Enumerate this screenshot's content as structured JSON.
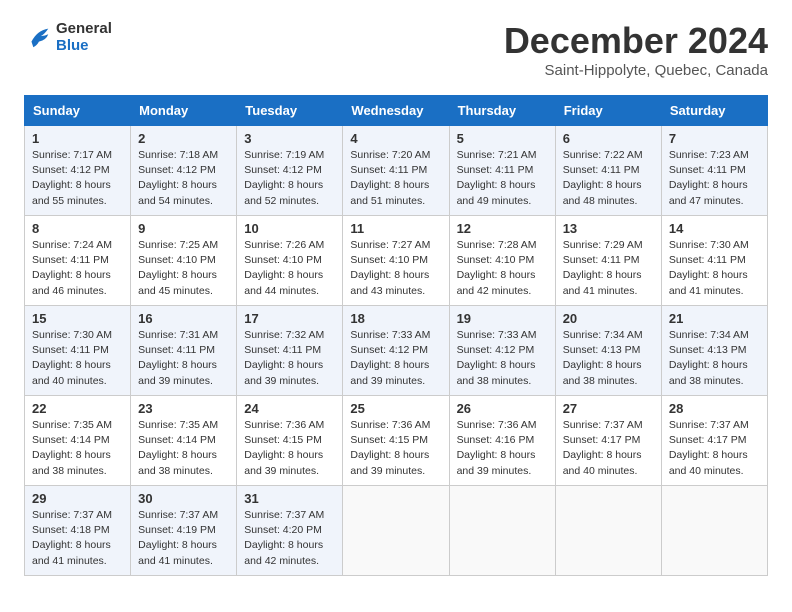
{
  "logo": {
    "line1": "General",
    "line2": "Blue"
  },
  "title": "December 2024",
  "location": "Saint-Hippolyte, Quebec, Canada",
  "weekdays": [
    "Sunday",
    "Monday",
    "Tuesday",
    "Wednesday",
    "Thursday",
    "Friday",
    "Saturday"
  ],
  "weeks": [
    [
      {
        "day": "1",
        "sunrise": "Sunrise: 7:17 AM",
        "sunset": "Sunset: 4:12 PM",
        "daylight": "Daylight: 8 hours and 55 minutes."
      },
      {
        "day": "2",
        "sunrise": "Sunrise: 7:18 AM",
        "sunset": "Sunset: 4:12 PM",
        "daylight": "Daylight: 8 hours and 54 minutes."
      },
      {
        "day": "3",
        "sunrise": "Sunrise: 7:19 AM",
        "sunset": "Sunset: 4:12 PM",
        "daylight": "Daylight: 8 hours and 52 minutes."
      },
      {
        "day": "4",
        "sunrise": "Sunrise: 7:20 AM",
        "sunset": "Sunset: 4:11 PM",
        "daylight": "Daylight: 8 hours and 51 minutes."
      },
      {
        "day": "5",
        "sunrise": "Sunrise: 7:21 AM",
        "sunset": "Sunset: 4:11 PM",
        "daylight": "Daylight: 8 hours and 49 minutes."
      },
      {
        "day": "6",
        "sunrise": "Sunrise: 7:22 AM",
        "sunset": "Sunset: 4:11 PM",
        "daylight": "Daylight: 8 hours and 48 minutes."
      },
      {
        "day": "7",
        "sunrise": "Sunrise: 7:23 AM",
        "sunset": "Sunset: 4:11 PM",
        "daylight": "Daylight: 8 hours and 47 minutes."
      }
    ],
    [
      {
        "day": "8",
        "sunrise": "Sunrise: 7:24 AM",
        "sunset": "Sunset: 4:11 PM",
        "daylight": "Daylight: 8 hours and 46 minutes."
      },
      {
        "day": "9",
        "sunrise": "Sunrise: 7:25 AM",
        "sunset": "Sunset: 4:10 PM",
        "daylight": "Daylight: 8 hours and 45 minutes."
      },
      {
        "day": "10",
        "sunrise": "Sunrise: 7:26 AM",
        "sunset": "Sunset: 4:10 PM",
        "daylight": "Daylight: 8 hours and 44 minutes."
      },
      {
        "day": "11",
        "sunrise": "Sunrise: 7:27 AM",
        "sunset": "Sunset: 4:10 PM",
        "daylight": "Daylight: 8 hours and 43 minutes."
      },
      {
        "day": "12",
        "sunrise": "Sunrise: 7:28 AM",
        "sunset": "Sunset: 4:10 PM",
        "daylight": "Daylight: 8 hours and 42 minutes."
      },
      {
        "day": "13",
        "sunrise": "Sunrise: 7:29 AM",
        "sunset": "Sunset: 4:11 PM",
        "daylight": "Daylight: 8 hours and 41 minutes."
      },
      {
        "day": "14",
        "sunrise": "Sunrise: 7:30 AM",
        "sunset": "Sunset: 4:11 PM",
        "daylight": "Daylight: 8 hours and 41 minutes."
      }
    ],
    [
      {
        "day": "15",
        "sunrise": "Sunrise: 7:30 AM",
        "sunset": "Sunset: 4:11 PM",
        "daylight": "Daylight: 8 hours and 40 minutes."
      },
      {
        "day": "16",
        "sunrise": "Sunrise: 7:31 AM",
        "sunset": "Sunset: 4:11 PM",
        "daylight": "Daylight: 8 hours and 39 minutes."
      },
      {
        "day": "17",
        "sunrise": "Sunrise: 7:32 AM",
        "sunset": "Sunset: 4:11 PM",
        "daylight": "Daylight: 8 hours and 39 minutes."
      },
      {
        "day": "18",
        "sunrise": "Sunrise: 7:33 AM",
        "sunset": "Sunset: 4:12 PM",
        "daylight": "Daylight: 8 hours and 39 minutes."
      },
      {
        "day": "19",
        "sunrise": "Sunrise: 7:33 AM",
        "sunset": "Sunset: 4:12 PM",
        "daylight": "Daylight: 8 hours and 38 minutes."
      },
      {
        "day": "20",
        "sunrise": "Sunrise: 7:34 AM",
        "sunset": "Sunset: 4:13 PM",
        "daylight": "Daylight: 8 hours and 38 minutes."
      },
      {
        "day": "21",
        "sunrise": "Sunrise: 7:34 AM",
        "sunset": "Sunset: 4:13 PM",
        "daylight": "Daylight: 8 hours and 38 minutes."
      }
    ],
    [
      {
        "day": "22",
        "sunrise": "Sunrise: 7:35 AM",
        "sunset": "Sunset: 4:14 PM",
        "daylight": "Daylight: 8 hours and 38 minutes."
      },
      {
        "day": "23",
        "sunrise": "Sunrise: 7:35 AM",
        "sunset": "Sunset: 4:14 PM",
        "daylight": "Daylight: 8 hours and 38 minutes."
      },
      {
        "day": "24",
        "sunrise": "Sunrise: 7:36 AM",
        "sunset": "Sunset: 4:15 PM",
        "daylight": "Daylight: 8 hours and 39 minutes."
      },
      {
        "day": "25",
        "sunrise": "Sunrise: 7:36 AM",
        "sunset": "Sunset: 4:15 PM",
        "daylight": "Daylight: 8 hours and 39 minutes."
      },
      {
        "day": "26",
        "sunrise": "Sunrise: 7:36 AM",
        "sunset": "Sunset: 4:16 PM",
        "daylight": "Daylight: 8 hours and 39 minutes."
      },
      {
        "day": "27",
        "sunrise": "Sunrise: 7:37 AM",
        "sunset": "Sunset: 4:17 PM",
        "daylight": "Daylight: 8 hours and 40 minutes."
      },
      {
        "day": "28",
        "sunrise": "Sunrise: 7:37 AM",
        "sunset": "Sunset: 4:17 PM",
        "daylight": "Daylight: 8 hours and 40 minutes."
      }
    ],
    [
      {
        "day": "29",
        "sunrise": "Sunrise: 7:37 AM",
        "sunset": "Sunset: 4:18 PM",
        "daylight": "Daylight: 8 hours and 41 minutes."
      },
      {
        "day": "30",
        "sunrise": "Sunrise: 7:37 AM",
        "sunset": "Sunset: 4:19 PM",
        "daylight": "Daylight: 8 hours and 41 minutes."
      },
      {
        "day": "31",
        "sunrise": "Sunrise: 7:37 AM",
        "sunset": "Sunset: 4:20 PM",
        "daylight": "Daylight: 8 hours and 42 minutes."
      },
      null,
      null,
      null,
      null
    ]
  ]
}
